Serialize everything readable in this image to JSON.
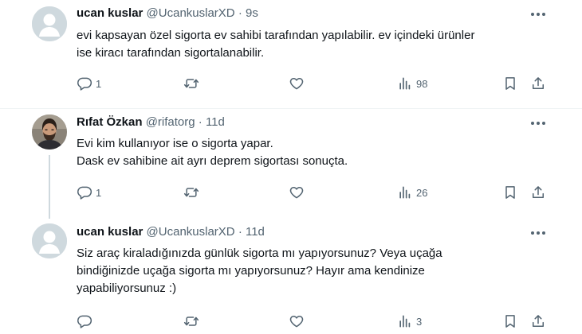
{
  "tweets": [
    {
      "name": "ucan kuslar",
      "handle": "@UcankuslarXD",
      "sep": "·",
      "time": "9s",
      "lines": [
        "evi kapsayan özel sigorta ev sahibi tarafından yapılabilir. ev içindeki ürünler",
        "ise kiracı tarafından sigortalanabilir."
      ],
      "replies": "1",
      "retweets": "",
      "likes": "",
      "views": "98"
    },
    {
      "name": "Rıfat Özkan",
      "handle": "@rifatorg",
      "sep": "·",
      "time": "11d",
      "lines": [
        "Evi kim kullanıyor ise o sigorta yapar.",
        "Dask ev sahibine ait ayrı deprem sigortası sonuçta."
      ],
      "replies": "1",
      "retweets": "",
      "likes": "",
      "views": "26"
    },
    {
      "name": "ucan kuslar",
      "handle": "@UcankuslarXD",
      "sep": "·",
      "time": "11d",
      "lines": [
        "Siz araç kiraladığınızda günlük sigorta mı yapıyorsunuz? Veya uçağa",
        "bindiğinizde uçağa sigorta mı yapıyorsunuz? Hayır ama kendinize",
        "yapabiliyorsunuz :)"
      ],
      "replies": "",
      "retweets": "",
      "likes": "",
      "views": "3"
    }
  ],
  "icons": {
    "reply": "reply-icon",
    "retweet": "retweet-icon",
    "like": "heart-icon",
    "views": "views-bar-chart-icon",
    "bookmark": "bookmark-icon",
    "share": "share-icon",
    "more": "more-dots-icon"
  },
  "colors": {
    "text": "#0f1419",
    "muted": "#536471",
    "divider": "#eff3f4",
    "default_avatar": "#cfd9de"
  }
}
